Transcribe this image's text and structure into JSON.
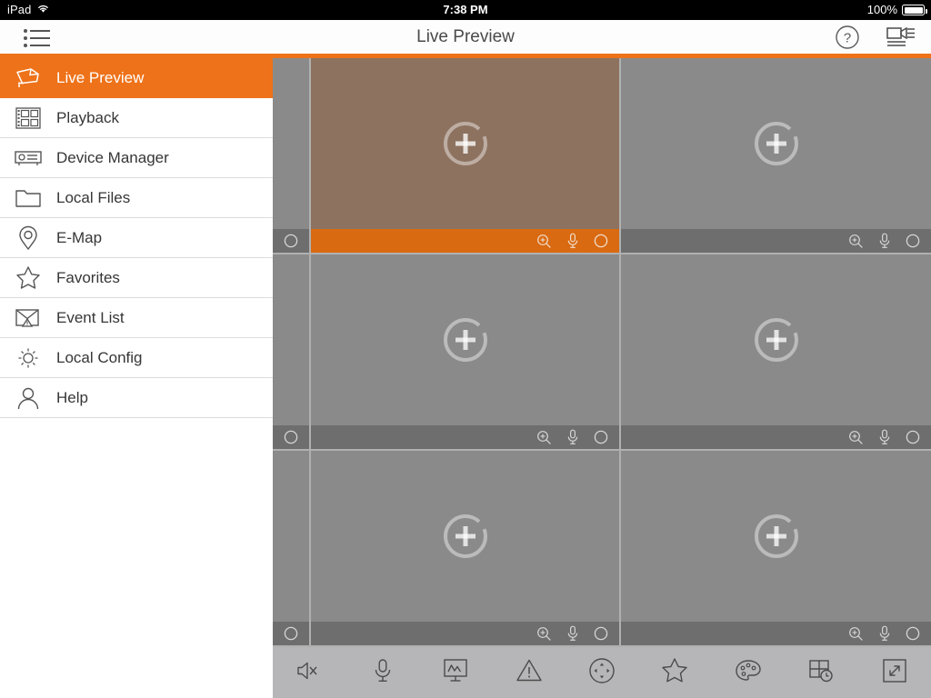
{
  "status_bar": {
    "carrier": "iPad",
    "wifi_icon": "wifi-icon",
    "time": "7:38 PM",
    "battery_percent": "100%",
    "battery_icon": "battery-full-icon"
  },
  "nav": {
    "menu_icon": "list-menu-icon",
    "title": "Live Preview",
    "help_icon": "question-circle-icon",
    "device_list_icon": "camera-list-icon",
    "accent_color": "#ee7219"
  },
  "sidebar": {
    "items": [
      {
        "label": "Live Preview",
        "icon": "video-camera-icon",
        "active": true
      },
      {
        "label": "Playback",
        "icon": "film-strip-icon",
        "active": false
      },
      {
        "label": "Device Manager",
        "icon": "device-box-icon",
        "active": false
      },
      {
        "label": "Local Files",
        "icon": "folder-icon",
        "active": false
      },
      {
        "label": "E-Map",
        "icon": "map-pin-icon",
        "active": false
      },
      {
        "label": "Favorites",
        "icon": "star-icon",
        "active": false
      },
      {
        "label": "Event List",
        "icon": "envelope-alert-icon",
        "active": false
      },
      {
        "label": "Local Config",
        "icon": "gear-icon",
        "active": false
      },
      {
        "label": "Help",
        "icon": "person-icon",
        "active": false
      }
    ]
  },
  "grid": {
    "rows": 3,
    "columns": 3,
    "cell_placeholder_icon": "add-camera-plus-icon",
    "selected_cell_index": 1,
    "selected_color": "#8d7260",
    "empty_color": "#8a8a8a",
    "cell_toolbar": {
      "zoom_icon": "digital-zoom-icon",
      "mic_icon": "microphone-icon",
      "record_icon": "record-circle-icon"
    }
  },
  "bottom_toolbar": {
    "items": [
      {
        "icon": "speaker-mute-icon",
        "name": "audio-toggle"
      },
      {
        "icon": "microphone-icon",
        "name": "two-way-talk"
      },
      {
        "icon": "stream-monitor-icon",
        "name": "stream-quality"
      },
      {
        "icon": "alarm-triangle-icon",
        "name": "alarm-output"
      },
      {
        "icon": "ptz-control-icon",
        "name": "ptz-control"
      },
      {
        "icon": "star-icon",
        "name": "favorites"
      },
      {
        "icon": "color-palette-icon",
        "name": "image-settings"
      },
      {
        "icon": "layout-clock-icon",
        "name": "window-layout"
      },
      {
        "icon": "expand-arrows-icon",
        "name": "full-screen"
      }
    ]
  }
}
